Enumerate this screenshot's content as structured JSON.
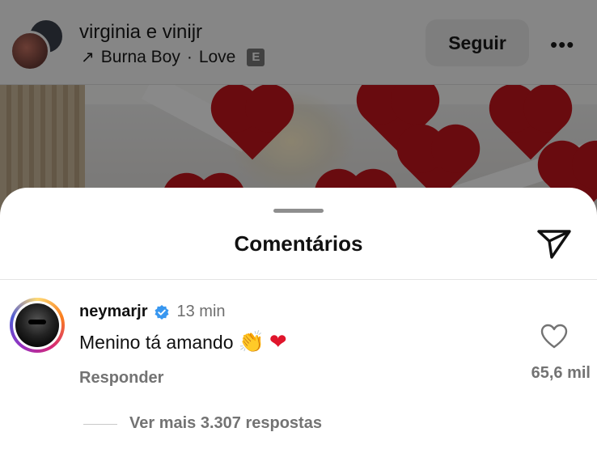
{
  "post": {
    "username": "virginia e vinijr",
    "music_artist": "Burna Boy",
    "music_separator": "·",
    "music_track": "Love",
    "explicit_badge": "E",
    "follow_label": "Seguir",
    "more_glyph": "•••",
    "arrow_glyph": "↗"
  },
  "sheet": {
    "title": "Comentários"
  },
  "comment": {
    "username": "neymarjr",
    "time": "13 min",
    "text": "Menino tá amando",
    "emoji_clap": "👏",
    "emoji_heart": "❤",
    "reply_label": "Responder",
    "like_count": "65,6 mil",
    "more_replies": "Ver mais 3.307 respostas"
  },
  "colors": {
    "verified": "#3897f0",
    "secondary_text": "#737373",
    "heart_emoji": "#e0152b"
  }
}
